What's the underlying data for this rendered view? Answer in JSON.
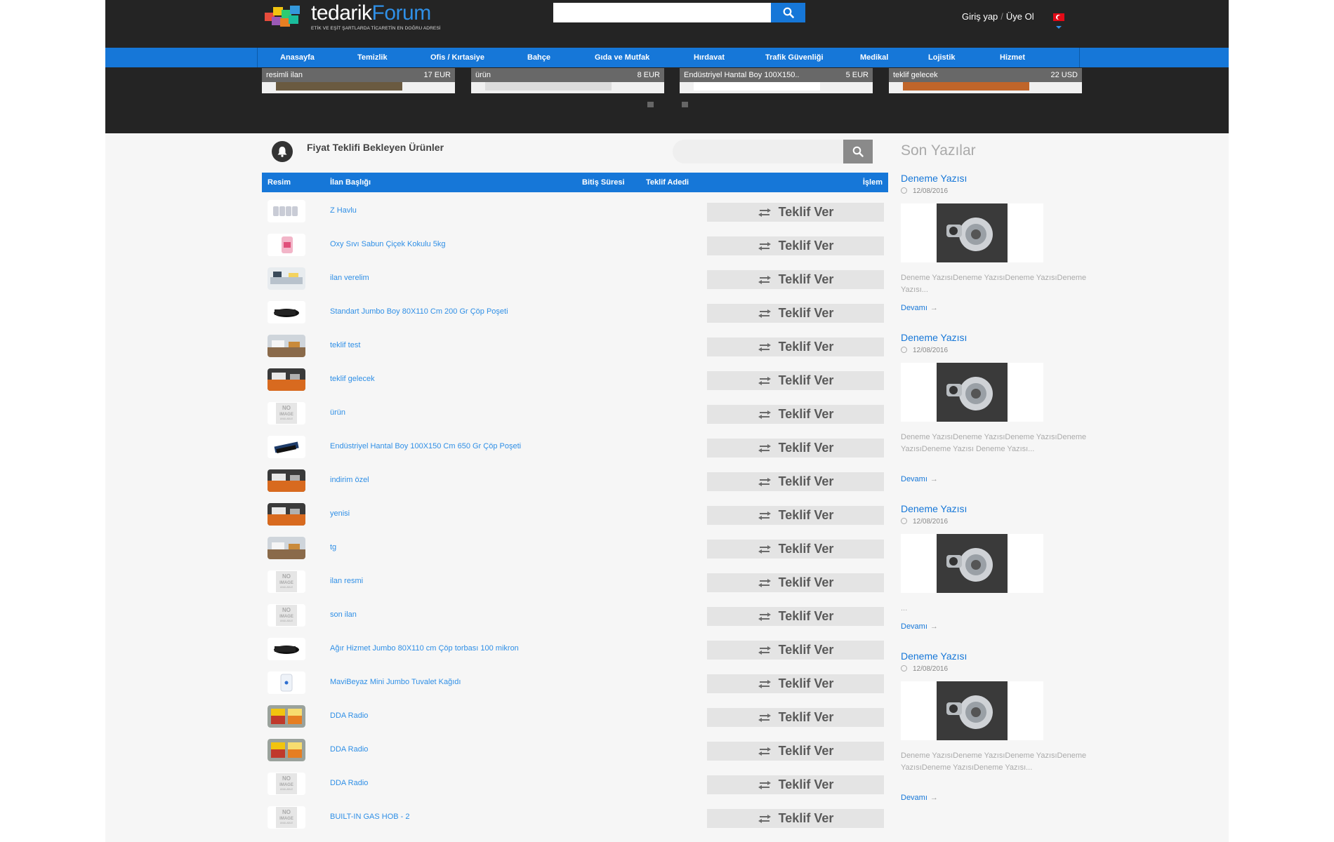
{
  "header": {
    "brand_left": "tedarik",
    "brand_right": "Forum",
    "tagline": "ETİK VE EŞİT ŞARTLARDA TİCARETİN EN DOĞRU ADRESİ",
    "search_placeholder": "",
    "login_label": "Giriş yap",
    "separator": "/",
    "register_label": "Üye Ol"
  },
  "nav": {
    "items": [
      "Anasayfa",
      "Temizlik",
      "Ofis / Kırtasiye",
      "Bahçe",
      "Gıda ve Mutfak",
      "Hırdavat",
      "Trafik Güvenliği",
      "Medikal",
      "Lojistik",
      "Hizmet"
    ]
  },
  "carousel": {
    "items": [
      {
        "title": "resimli ilan",
        "price": "17 EUR"
      },
      {
        "title": "ürün",
        "price": "8 EUR"
      },
      {
        "title": "Endüstriyel Hantal Boy 100X150..",
        "price": "5 EUR"
      },
      {
        "title": "teklif gelecek",
        "price": "22 USD"
      }
    ]
  },
  "section": {
    "title": "Fiyat Teklifi Bekleyen Ürünler",
    "search_placeholder": ""
  },
  "table": {
    "headers": {
      "image": "Resim",
      "title": "İlan Başlığı",
      "expiry": "Bitiş Süresi",
      "offers": "Teklif Adedi",
      "action": "İşlem"
    },
    "action_label": "Teklif Ver",
    "rows": [
      {
        "title": "Z Havlu",
        "thumb": "towels"
      },
      {
        "title": "Oxy Sıvı Sabun Çiçek Kokulu 5kg",
        "thumb": "soap"
      },
      {
        "title": "ilan verelim",
        "thumb": "office"
      },
      {
        "title": "Standart Jumbo Boy 80X110 Cm 200 Gr Çöp Poşeti",
        "thumb": "bag"
      },
      {
        "title": "teklif test",
        "thumb": "room"
      },
      {
        "title": "teklif gelecek",
        "thumb": "room2"
      },
      {
        "title": "ürün",
        "thumb": "noimage"
      },
      {
        "title": "Endüstriyel Hantal Boy 100X150 Cm 650 Gr Çöp Poşeti",
        "thumb": "bagblue"
      },
      {
        "title": "indirim özel",
        "thumb": "room2"
      },
      {
        "title": "yenisi",
        "thumb": "room2"
      },
      {
        "title": "tg",
        "thumb": "room"
      },
      {
        "title": "ilan resmi",
        "thumb": "noimage"
      },
      {
        "title": "son ilan",
        "thumb": "noimage"
      },
      {
        "title": "Ağır Hizmet Jumbo 80X110 cm Çöp torbası 100 mikron",
        "thumb": "bag"
      },
      {
        "title": "MaviBeyaz Mini Jumbo Tuvalet Kağıdı",
        "thumb": "paper"
      },
      {
        "title": "DDA Radio",
        "thumb": "radio"
      },
      {
        "title": "DDA Radio",
        "thumb": "radio"
      },
      {
        "title": "DDA Radio",
        "thumb": "noimage"
      },
      {
        "title": "BUILT-IN GAS HOB - 2",
        "thumb": "noimage"
      }
    ]
  },
  "noimage": {
    "line1": "NO",
    "line2": "IMAGE",
    "line3": "AVAILABLE"
  },
  "sidebar": {
    "title": "Son Yazılar",
    "more_label": "Devamı",
    "posts": [
      {
        "title": "Deneme Yazısı",
        "date": "12/08/2016",
        "excerpt": "Deneme YazısıDeneme YazısıDeneme YazısıDeneme Yazısı..."
      },
      {
        "title": "Deneme Yazısı",
        "date": "12/08/2016",
        "excerpt": "Deneme YazısıDeneme YazısıDeneme YazısıDeneme YazısıDeneme Yazısı Deneme Yazısı..."
      },
      {
        "title": "Deneme Yazısı",
        "date": "12/08/2016",
        "excerpt": "..."
      },
      {
        "title": "Deneme Yazısı",
        "date": "12/08/2016",
        "excerpt": "Deneme YazısıDeneme YazısıDeneme YazısıDeneme YazısıDeneme YazısıDeneme Yazısı..."
      }
    ]
  },
  "colors": {
    "accent": "#1677d8",
    "dark": "#242424",
    "link": "#2f8fe6"
  }
}
